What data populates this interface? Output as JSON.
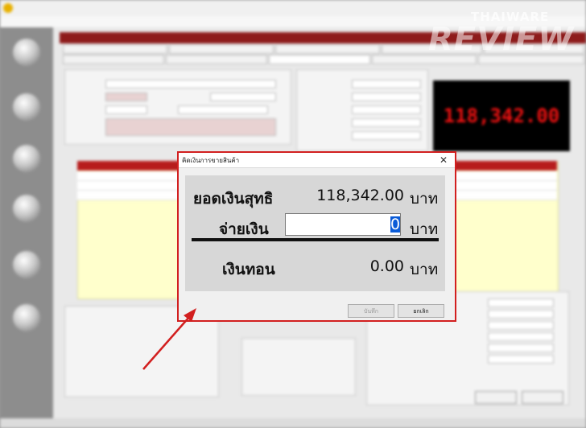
{
  "dialog": {
    "title": "คิดเงินการขายสินค้า",
    "close_glyph": "✕",
    "net_label": "ยอดเงินสุทธิ",
    "net_value": "118,342.00",
    "net_unit": "บาท",
    "pay_label": "จ่ายเงิน",
    "pay_value": "0",
    "pay_unit": "บาท",
    "change_label": "เงินทอน",
    "change_value": "0.00",
    "change_unit": "บาท",
    "save_button": "บันทึก",
    "cancel_button": "ยกเลิก"
  },
  "display": {
    "total": "118,342.00"
  },
  "watermark": {
    "top": "THAIWARE",
    "main": "REVIEW"
  },
  "colors": {
    "accent_red": "#d21f1f",
    "panel_red": "#8e1b1b",
    "selection_blue": "#0a5bd7",
    "display_red": "#e11111"
  }
}
